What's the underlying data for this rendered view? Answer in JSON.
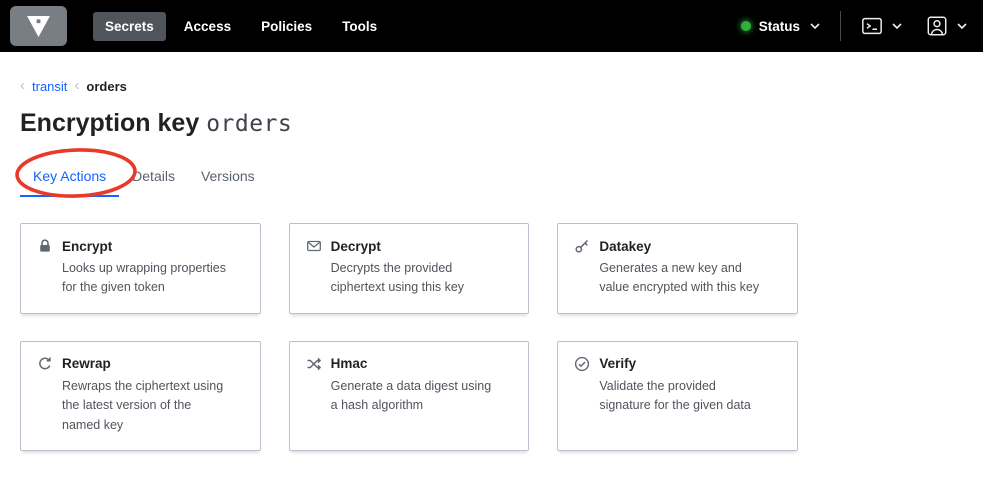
{
  "navbar": {
    "items": [
      {
        "label": "Secrets",
        "active": true
      },
      {
        "label": "Access",
        "active": false
      },
      {
        "label": "Policies",
        "active": false
      },
      {
        "label": "Tools",
        "active": false
      }
    ],
    "status_label": "Status",
    "icons": [
      "vault-logo-icon",
      "terminal-icon",
      "user-icon",
      "chevron-down-icon"
    ]
  },
  "breadcrumb": {
    "items": [
      {
        "label": "transit"
      },
      {
        "label": "orders"
      }
    ]
  },
  "page": {
    "title_prefix": "Encryption key",
    "key_name": "orders"
  },
  "tabs": [
    {
      "label": "Key Actions",
      "active": true
    },
    {
      "label": "Details",
      "active": false
    },
    {
      "label": "Versions",
      "active": false
    }
  ],
  "cards": [
    {
      "icon": "lock-icon",
      "title": "Encrypt",
      "description": "Looks up wrapping properties\nfor the given token"
    },
    {
      "icon": "envelope-icon",
      "title": "Decrypt",
      "description": "Decrypts the provided\nciphertext using this key"
    },
    {
      "icon": "key-icon",
      "title": "Datakey",
      "description": "Generates a new key and\nvalue encrypted with this key"
    },
    {
      "icon": "rotate-icon",
      "title": "Rewrap",
      "description": "Rewraps the ciphertext using\nthe latest version of the\nnamed key"
    },
    {
      "icon": "shuffle-icon",
      "title": "Hmac",
      "description": "Generate a data digest using\na hash algorithm"
    },
    {
      "icon": "check-circle-icon",
      "title": "Verify",
      "description": "Validate the provided\nsignature for the given data"
    }
  ],
  "annotation": {
    "type": "hand-drawn-ellipse",
    "color": "#e8392a",
    "target": "Key Actions tab"
  },
  "colors": {
    "accent": "#1563ff",
    "navbar_bg": "#000000",
    "status_green": "#2eb039",
    "card_border": "#bac1cc",
    "text_dark": "#1f2124",
    "text_muted": "#50545c"
  }
}
